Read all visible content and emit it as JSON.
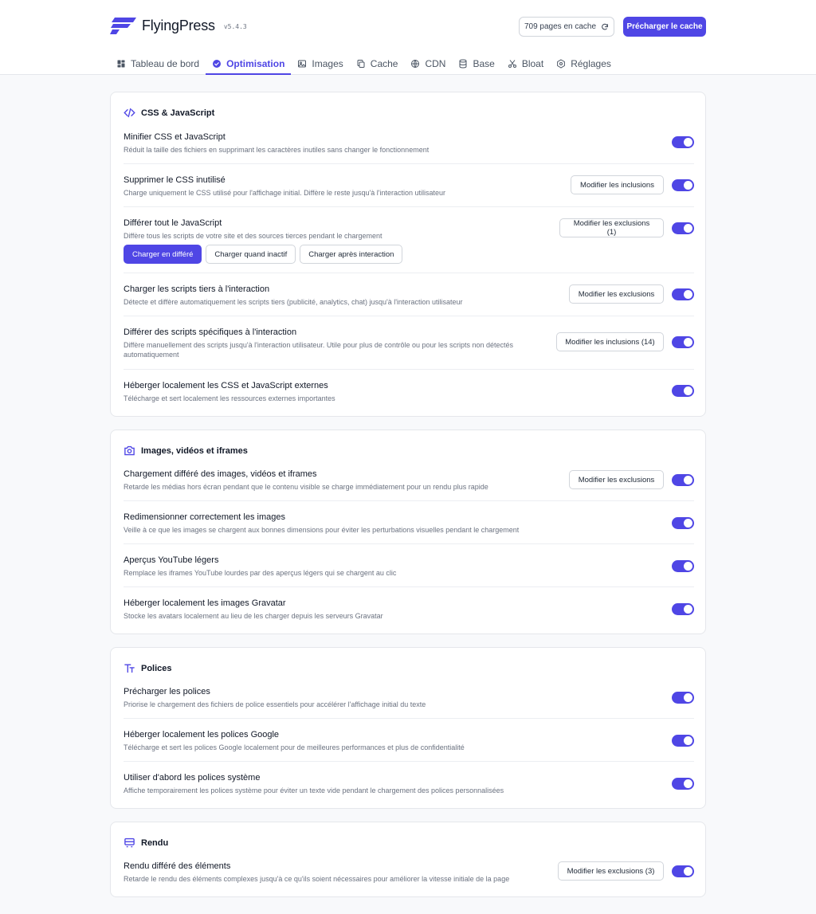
{
  "header": {
    "app_name": "FlyingPress",
    "version": "v5.4.3",
    "cache_count": "709 pages en cache",
    "preload_label": "Précharger le cache",
    "accent": "#4f46e5"
  },
  "tabs": [
    {
      "label": "Tableau de bord",
      "icon": "dashboard-icon"
    },
    {
      "label": "Optimisation",
      "icon": "check-badge-icon",
      "active": true
    },
    {
      "label": "Images",
      "icon": "image-icon"
    },
    {
      "label": "Cache",
      "icon": "copy-icon"
    },
    {
      "label": "CDN",
      "icon": "globe-icon"
    },
    {
      "label": "Base",
      "icon": "database-icon"
    },
    {
      "label": "Bloat",
      "icon": "scissors-icon"
    },
    {
      "label": "Réglages",
      "icon": "gear-icon"
    }
  ],
  "sections": {
    "css": {
      "title": "CSS & JavaScript",
      "rows": [
        {
          "title": "Minifier CSS et JavaScript",
          "desc": "Réduit la taille des fichiers en supprimant les caractères inutiles sans changer le fonctionnement",
          "enabled": true
        },
        {
          "title": "Supprimer le CSS inutilisé",
          "desc": "Charge uniquement le CSS utilisé pour l'affichage initial. Diffère le reste jusqu'à l'interaction utilisateur",
          "button": "Modifier les inclusions",
          "enabled": true
        },
        {
          "title": "Différer tout le JavaScript",
          "desc": "Diffère tous les scripts de votre site et des sources tierces pendant le chargement",
          "button": "Modifier les exclusions (1)",
          "enabled": true,
          "modes": [
            "Charger en différé",
            "Charger quand inactif",
            "Charger après interaction"
          ],
          "active_mode": "Charger en différé"
        },
        {
          "title": "Charger les scripts tiers à l'interaction",
          "desc": "Détecte et diffère automatiquement les scripts tiers (publicité, analytics, chat) jusqu'à l'interaction utilisateur",
          "button": "Modifier les exclusions",
          "enabled": true
        },
        {
          "title": "Différer des scripts spécifiques à l'interaction",
          "desc": "Diffère manuellement des scripts jusqu'à l'interaction utilisateur. Utile pour plus de contrôle ou pour les scripts non détectés automatiquement",
          "button": "Modifier les inclusions (14)",
          "enabled": true
        },
        {
          "title": "Héberger localement les CSS et JavaScript externes",
          "desc": "Télécharge et sert localement les ressources externes importantes",
          "enabled": true
        }
      ]
    },
    "images": {
      "title": "Images, vidéos et iframes",
      "rows": [
        {
          "title": "Chargement différé des images, vidéos et iframes",
          "desc": "Retarde les médias hors écran pendant que le contenu visible se charge immédiatement pour un rendu plus rapide",
          "button": "Modifier les exclusions",
          "enabled": true
        },
        {
          "title": "Redimensionner correctement les images",
          "desc": "Veille à ce que les images se chargent aux bonnes dimensions pour éviter les perturbations visuelles pendant le chargement",
          "enabled": true
        },
        {
          "title": "Aperçus YouTube légers",
          "desc": "Remplace les iframes YouTube lourdes par des aperçus légers qui se chargent au clic",
          "enabled": true
        },
        {
          "title": "Héberger localement les images Gravatar",
          "desc": "Stocke les avatars localement au lieu de les charger depuis les serveurs Gravatar",
          "enabled": true
        }
      ]
    },
    "fonts": {
      "title": "Polices",
      "rows": [
        {
          "title": "Précharger les polices",
          "desc": "Priorise le chargement des fichiers de police essentiels pour accélérer l'affichage initial du texte",
          "enabled": true
        },
        {
          "title": "Héberger localement les polices Google",
          "desc": "Télécharge et sert les polices Google localement pour de meilleures performances et plus de confidentialité",
          "enabled": true
        },
        {
          "title": "Utiliser d'abord les polices système",
          "desc": "Affiche temporairement les polices système pour éviter un texte vide pendant le chargement des polices personnalisées",
          "enabled": true
        }
      ]
    },
    "rendering": {
      "title": "Rendu",
      "rows": [
        {
          "title": "Rendu différé des éléments",
          "desc": "Retarde le rendu des éléments complexes jusqu'à ce qu'ils soient nécessaires pour améliorer la vitesse initiale de la page",
          "button": "Modifier les exclusions (3)",
          "enabled": true
        }
      ]
    }
  }
}
